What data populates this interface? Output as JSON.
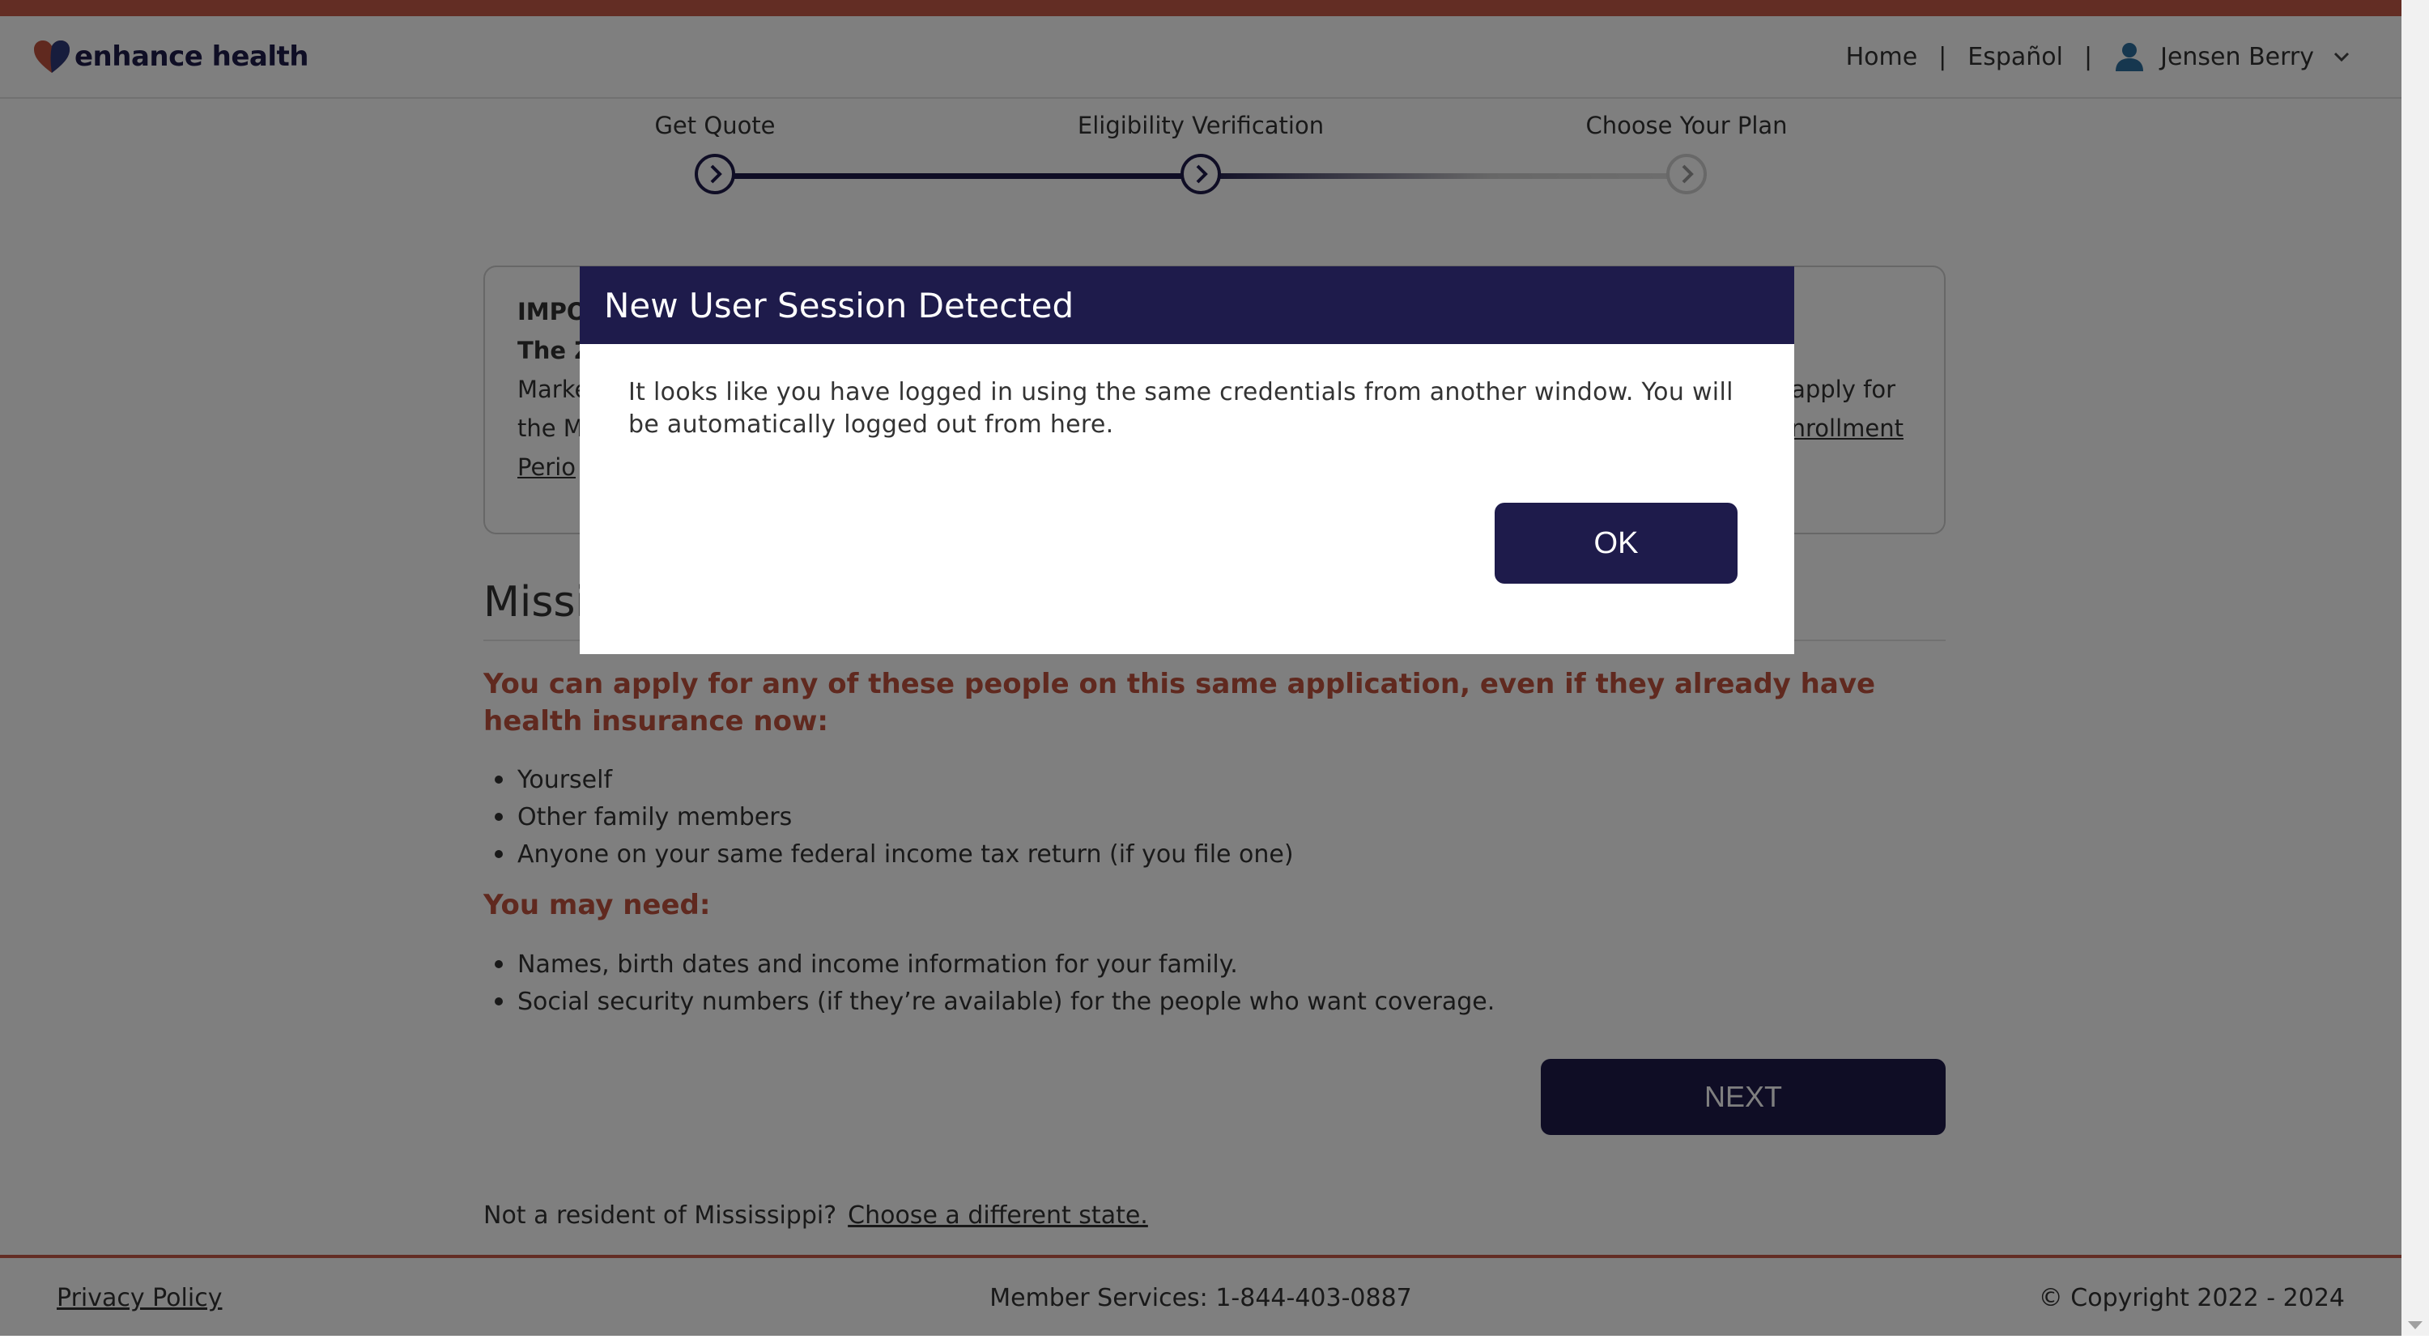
{
  "header": {
    "logo_text": "enhance health",
    "nav": {
      "home": "Home",
      "separator": "|",
      "language": "Español",
      "user_name": "Jensen Berry"
    }
  },
  "stepper": {
    "steps": [
      {
        "label": "Get Quote",
        "state": "complete"
      },
      {
        "label": "Eligibility Verification",
        "state": "current"
      },
      {
        "label": "Choose Your Plan",
        "state": "upcoming"
      }
    ]
  },
  "notice": {
    "line1": "IMPO",
    "line2": "The Z",
    "line3": "Marke",
    "line4": "the M",
    "line5": "Perio",
    "right3": "apply for",
    "right4": "nrollment"
  },
  "main": {
    "state_title": "Missi",
    "intro": "You can apply for any of these people on this same application, even if they already have health insurance now:",
    "people": [
      "Yourself",
      "Other family members",
      "Anyone on your same federal income tax return (if you file one)"
    ],
    "need_heading": "You may need:",
    "needs": [
      "Names, birth dates and income information for your family.",
      "Social security numbers (if they’re available) for the people who want coverage."
    ],
    "next_label": "NEXT",
    "resident_text": "Not a resident of  Mississippi?",
    "resident_link": "Choose a different state."
  },
  "footer": {
    "privacy": "Privacy Policy",
    "services": "Member Services: 1-844-403-0887",
    "copyright": "© Copyright 2022 - 2024"
  },
  "modal": {
    "title": "New User Session Detected",
    "message": "It looks like you have logged in using the same credentials from another window. You will be automatically logged out from here.",
    "ok_label": "OK"
  },
  "colors": {
    "brand_navy": "#1e1b4b",
    "accent_red": "#c0533f",
    "top_bar": "#c65a48"
  }
}
